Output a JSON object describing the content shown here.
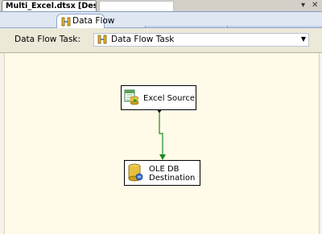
{
  "document": {
    "tab_title": "Multi_Excel.dtsx [Design]*",
    "controls": {
      "dropdown": "▾",
      "close": "✕"
    }
  },
  "designer": {
    "tabs": [
      {
        "label": "Data Flow",
        "icon": "data-flow-icon",
        "selected": true
      }
    ],
    "task": {
      "label": "Data Flow Task:",
      "selected": "Data Flow Task",
      "icon": "data-flow-task-icon"
    }
  },
  "canvas": {
    "components": [
      {
        "name": "Excel Source",
        "icon": "excel-source-icon"
      },
      {
        "name_line1": "OLE DB",
        "name_line2": "Destination",
        "icon": "ole-db-destination-icon"
      }
    ],
    "path_color": "#008000"
  }
}
